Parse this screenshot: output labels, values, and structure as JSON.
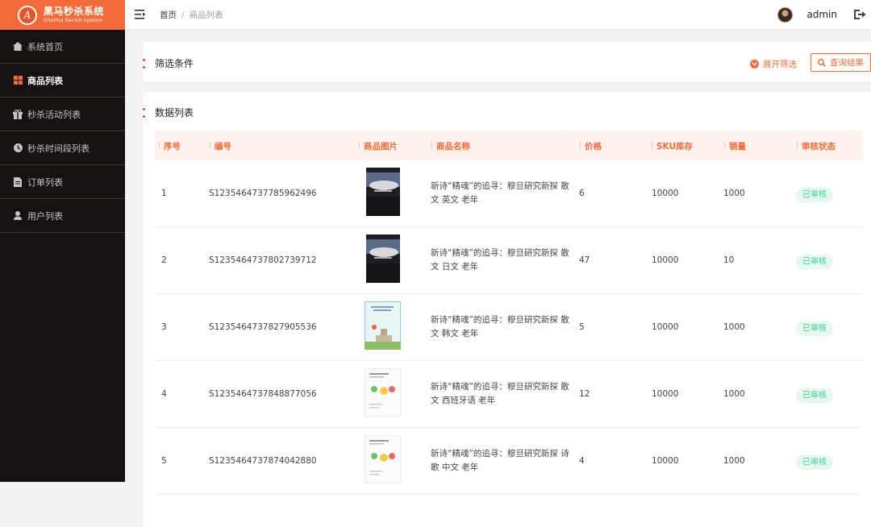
{
  "app": {
    "logo_mark": "A",
    "title": "黑马秒杀系统",
    "subtitle": "itheima Seckill system",
    "brand_color": "#f26b3a"
  },
  "sidebar": {
    "items": [
      {
        "label": "系统首页",
        "icon": "home-icon",
        "active": false
      },
      {
        "label": "商品列表",
        "icon": "grid-icon",
        "active": true
      },
      {
        "label": "秒杀活动列表",
        "icon": "gift-icon",
        "active": false
      },
      {
        "label": "秒杀时间段列表",
        "icon": "clock-icon",
        "active": false
      },
      {
        "label": "订单列表",
        "icon": "document-icon",
        "active": false
      },
      {
        "label": "用户列表",
        "icon": "user-icon",
        "active": false
      }
    ]
  },
  "header": {
    "breadcrumb": [
      "首页",
      "商品列表"
    ],
    "breadcrumb_sep": "/",
    "username": "admin"
  },
  "filter": {
    "title": "筛选条件",
    "expand_label": "展开筛选",
    "query_label": "查询结果"
  },
  "list": {
    "title": "数据列表",
    "columns": [
      "序号",
      "编号",
      "商品图片",
      "商品名称",
      "价格",
      "SKU库存",
      "销量",
      "审核状态"
    ],
    "rows": [
      {
        "index": "1",
        "code": "S1235464737785962496",
        "image": "book-cover-dark",
        "name": "新诗“精魂”的追寻：穆旦研究新探 散文 英文 老年",
        "price": "6",
        "sku": "10000",
        "sales": "1000",
        "status": "已审核"
      },
      {
        "index": "2",
        "code": "S1235464737802739712",
        "image": "book-cover-dark",
        "name": "新诗“精魂”的追寻：穆旦研究新探 散文 日文 老年",
        "price": "47",
        "sku": "10000",
        "sales": "10",
        "status": "已审核"
      },
      {
        "index": "3",
        "code": "S1235464737827905536",
        "image": "book-cover-light",
        "name": "新诗“精魂”的追寻：穆旦研究新探 散文 韩文 老年",
        "price": "5",
        "sku": "10000",
        "sales": "1000",
        "status": "已审核"
      },
      {
        "index": "4",
        "code": "S1235464737848877056",
        "image": "book-cover-white",
        "name": "新诗“精魂”的追寻：穆旦研究新探 散文 西班牙语 老年",
        "price": "12",
        "sku": "10000",
        "sales": "1000",
        "status": "已审核"
      },
      {
        "index": "5",
        "code": "S1235464737874042880",
        "image": "book-cover-white",
        "name": "新诗“精魂”的追寻：穆旦研究新探 诗歌 中文 老年",
        "price": "4",
        "sku": "10000",
        "sales": "1000",
        "status": "已审核"
      }
    ]
  }
}
